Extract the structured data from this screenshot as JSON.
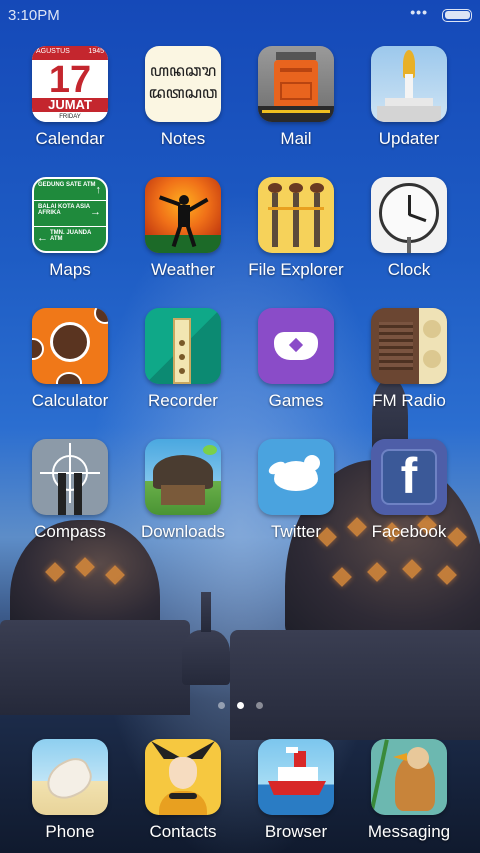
{
  "status_bar": {
    "time": "3:10PM",
    "dots": "•••"
  },
  "calendar_icon": {
    "month": "AGUSTUS",
    "year": "1945",
    "day": "17",
    "weekday": "JUMAT",
    "weekday_en": "FRIDAY"
  },
  "notes_icon": {
    "line1": "ꦲꦤꦕꦫ",
    "line2": "ꦢꦠꦱꦮ"
  },
  "maps_icon": {
    "sign1": "GEDUNG SATE ATM",
    "sign2": "BALAI KOTA ASIA AFRIKA",
    "sign3": "TMN. JUANDA ATM"
  },
  "apps": [
    {
      "label": "Calendar"
    },
    {
      "label": "Notes"
    },
    {
      "label": "Mail"
    },
    {
      "label": "Updater"
    },
    {
      "label": "Maps"
    },
    {
      "label": "Weather"
    },
    {
      "label": "File Explorer"
    },
    {
      "label": "Clock"
    },
    {
      "label": "Calculator"
    },
    {
      "label": "Recorder"
    },
    {
      "label": "Games"
    },
    {
      "label": "FM Radio"
    },
    {
      "label": "Compass"
    },
    {
      "label": "Downloads"
    },
    {
      "label": "Twitter"
    },
    {
      "label": "Facebook"
    }
  ],
  "dock": [
    {
      "label": "Phone"
    },
    {
      "label": "Contacts"
    },
    {
      "label": "Browser"
    },
    {
      "label": "Messaging"
    }
  ],
  "page_indicator": {
    "pages": 3,
    "current": 2
  },
  "colors": {
    "wallpaper_sky": "#1e5cc4",
    "calendar_red": "#c4262e",
    "maps_green": "#1f8a3c",
    "games_purple": "#8a4cc8",
    "twitter_blue": "#4aa3df",
    "facebook_blue": "#3b5998"
  }
}
